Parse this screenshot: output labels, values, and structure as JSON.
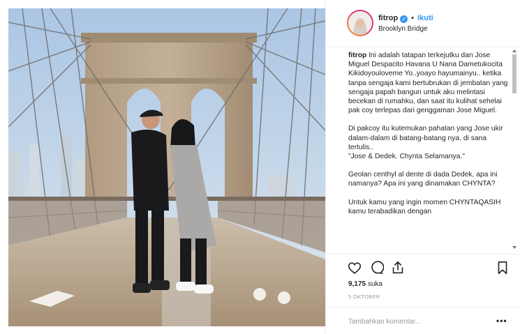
{
  "photo": {
    "alt_icon": "photo-brooklyn-bridge"
  },
  "header": {
    "username": "fitrop",
    "verified_icon": "verified-badge-icon",
    "separator": "•",
    "follow_label": "Ikuti",
    "location": "Brooklyn Bridge"
  },
  "caption": {
    "username": "fitrop",
    "paragraphs": [
      "Ini adalah tatapan terkejutku dan Jose Miguel Despacito Havana U Nana Dametukocita Kikidoyouloveme Yo..yoayo hayumainyu.. ketika tanpa sengaja kami bertubrukan di jembatan yang sengaja papah bangun untuk aku melintasi becekan di rumahku, dan saat itu kulihat sehelai pak coy terlepas dari genggaman Jose Miguel.",
      "Di pakcoy itu kutemukan pahatan yang Jose ukir dalam-dalam di batang-batang nya. di sana tertulis..",
      "\"Jose & Dedek. Chynta Selamanya.\"",
      "Geolan centhyl al dente di dada Dedek, apa ini namanya? Apa ini yang dinamakan CHYNTA?",
      "Untuk kamu yang ingin momen CHYNTAQASIH kamu terabadikan dengan"
    ]
  },
  "actions": {
    "like_icon": "heart-icon",
    "comment_icon": "comment-icon",
    "share_icon": "share-icon",
    "save_icon": "bookmark-icon"
  },
  "likes": {
    "count": "9,175",
    "label": "suka"
  },
  "date": "5 OKTOBER",
  "comment": {
    "placeholder": "Tambahkan komentar...",
    "more_label": "•••"
  },
  "colors": {
    "accent": "#3897f0",
    "text": "#262626",
    "muted": "#999999",
    "border": "#efefef"
  }
}
